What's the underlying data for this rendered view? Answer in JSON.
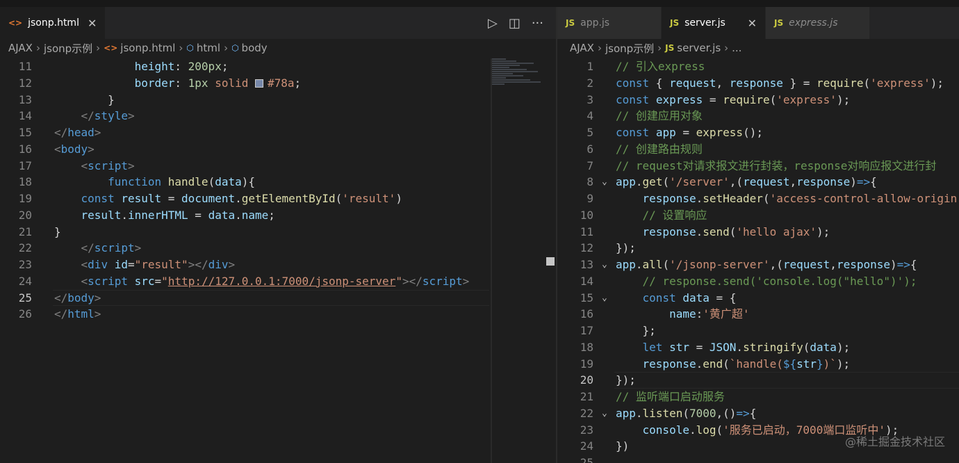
{
  "left": {
    "tab": {
      "name": "jsonp.html",
      "icon": "html-file-icon"
    },
    "actions": {
      "run": "▷",
      "split": "◫",
      "more": "···"
    },
    "breadcrumb": [
      "AJAX",
      "jsonp示例",
      "jsonp.html",
      "html",
      "body"
    ],
    "lines": [
      {
        "n": "11",
        "t": [
          [
            "i",
            "            "
          ],
          [
            "attr",
            "height"
          ],
          [
            "plain",
            ": "
          ],
          [
            "num",
            "200px"
          ],
          [
            "plain",
            ";"
          ]
        ]
      },
      {
        "n": "12",
        "t": [
          [
            "i",
            "            "
          ],
          [
            "attr",
            "border"
          ],
          [
            "plain",
            ": "
          ],
          [
            "num",
            "1px"
          ],
          [
            "plain",
            " "
          ],
          [
            "str",
            "solid"
          ],
          [
            "plain",
            " "
          ],
          [
            "swatch",
            ""
          ],
          [
            "str",
            "#78a"
          ],
          [
            "plain",
            ";"
          ]
        ]
      },
      {
        "n": "13",
        "t": [
          [
            "i",
            "        "
          ],
          [
            "plain",
            "}"
          ]
        ]
      },
      {
        "n": "14",
        "t": [
          [
            "i",
            "    "
          ],
          [
            "punc",
            "</"
          ],
          [
            "tag",
            "style"
          ],
          [
            "punc",
            ">"
          ]
        ]
      },
      {
        "n": "15",
        "t": [
          [
            "punc",
            "</"
          ],
          [
            "tag",
            "head"
          ],
          [
            "punc",
            ">"
          ]
        ]
      },
      {
        "n": "16",
        "t": [
          [
            "punc",
            "<"
          ],
          [
            "tag",
            "body"
          ],
          [
            "punc",
            ">"
          ]
        ]
      },
      {
        "n": "17",
        "t": [
          [
            "i",
            "    "
          ],
          [
            "punc",
            "<"
          ],
          [
            "tag",
            "script"
          ],
          [
            "punc",
            ">"
          ]
        ]
      },
      {
        "n": "18",
        "t": [
          [
            "i",
            "        "
          ],
          [
            "kw",
            "function"
          ],
          [
            "plain",
            " "
          ],
          [
            "fn",
            "handle"
          ],
          [
            "plain",
            "("
          ],
          [
            "var",
            "data"
          ],
          [
            "plain",
            "){"
          ]
        ]
      },
      {
        "n": "19",
        "t": [
          [
            "i",
            "    "
          ],
          [
            "kw",
            "const"
          ],
          [
            "plain",
            " "
          ],
          [
            "var",
            "result"
          ],
          [
            "plain",
            " = "
          ],
          [
            "var",
            "document"
          ],
          [
            "plain",
            "."
          ],
          [
            "fn",
            "getElementById"
          ],
          [
            "plain",
            "("
          ],
          [
            "str",
            "'result'"
          ],
          [
            "plain",
            ")"
          ]
        ]
      },
      {
        "n": "20",
        "t": [
          [
            "i",
            "    "
          ],
          [
            "var",
            "result"
          ],
          [
            "plain",
            "."
          ],
          [
            "var",
            "innerHTML"
          ],
          [
            "plain",
            " = "
          ],
          [
            "var",
            "data"
          ],
          [
            "plain",
            "."
          ],
          [
            "var",
            "name"
          ],
          [
            "plain",
            ";"
          ]
        ]
      },
      {
        "n": "21",
        "t": [
          [
            "plain",
            "}"
          ]
        ]
      },
      {
        "n": "22",
        "t": [
          [
            "i",
            "    "
          ],
          [
            "punc",
            "</"
          ],
          [
            "tag",
            "script"
          ],
          [
            "punc",
            ">"
          ]
        ]
      },
      {
        "n": "23",
        "t": [
          [
            "i",
            "    "
          ],
          [
            "punc",
            "<"
          ],
          [
            "tag",
            "div"
          ],
          [
            "plain",
            " "
          ],
          [
            "attr",
            "id"
          ],
          [
            "plain",
            "="
          ],
          [
            "str",
            "\"result\""
          ],
          [
            "punc",
            "></"
          ],
          [
            "tag",
            "div"
          ],
          [
            "punc",
            ">"
          ]
        ]
      },
      {
        "n": "24",
        "t": [
          [
            "i",
            "    "
          ],
          [
            "punc",
            "<"
          ],
          [
            "tag",
            "script"
          ],
          [
            "plain",
            " "
          ],
          [
            "attr",
            "src"
          ],
          [
            "plain",
            "="
          ],
          [
            "str",
            "\""
          ],
          [
            "stru",
            "http://127.0.0.1:7000/jsonp-server"
          ],
          [
            "str",
            "\""
          ],
          [
            "punc",
            "></"
          ],
          [
            "tag",
            "script"
          ],
          [
            "punc",
            ">"
          ]
        ]
      },
      {
        "n": "25",
        "t": [
          [
            "punc",
            "</"
          ],
          [
            "tag",
            "body"
          ],
          [
            "punc",
            ">"
          ]
        ],
        "current": true
      },
      {
        "n": "26",
        "t": [
          [
            "punc",
            "</"
          ],
          [
            "tag",
            "html"
          ],
          [
            "punc",
            ">"
          ]
        ]
      }
    ]
  },
  "right": {
    "tabs": [
      {
        "name": "app.js",
        "active": false,
        "italic": false,
        "close": ""
      },
      {
        "name": "server.js",
        "active": true,
        "italic": false,
        "close": "✕"
      },
      {
        "name": "express.js",
        "active": false,
        "italic": true,
        "close": ""
      }
    ],
    "js_icon_label": "JS",
    "breadcrumb": [
      "AJAX",
      "jsonp示例",
      "server.js",
      "..."
    ],
    "lines": [
      {
        "n": "1",
        "t": [
          [
            "cmt",
            "// 引入express"
          ]
        ]
      },
      {
        "n": "2",
        "t": [
          [
            "kw",
            "const"
          ],
          [
            "plain",
            " { "
          ],
          [
            "var",
            "request"
          ],
          [
            "plain",
            ", "
          ],
          [
            "var",
            "response"
          ],
          [
            "plain",
            " } = "
          ],
          [
            "fn",
            "require"
          ],
          [
            "plain",
            "("
          ],
          [
            "str",
            "'express'"
          ],
          [
            "plain",
            ");"
          ]
        ]
      },
      {
        "n": "3",
        "t": [
          [
            "kw",
            "const"
          ],
          [
            "plain",
            " "
          ],
          [
            "var",
            "express"
          ],
          [
            "plain",
            " = "
          ],
          [
            "fn",
            "require"
          ],
          [
            "plain",
            "("
          ],
          [
            "str",
            "'express'"
          ],
          [
            "plain",
            ");"
          ]
        ]
      },
      {
        "n": "4",
        "t": [
          [
            "cmt",
            "// 创建应用对象"
          ]
        ]
      },
      {
        "n": "5",
        "t": [
          [
            "kw",
            "const"
          ],
          [
            "plain",
            " "
          ],
          [
            "var",
            "app"
          ],
          [
            "plain",
            " = "
          ],
          [
            "fn",
            "express"
          ],
          [
            "plain",
            "();"
          ]
        ]
      },
      {
        "n": "6",
        "t": [
          [
            "cmt",
            "// 创建路由规则"
          ]
        ]
      },
      {
        "n": "7",
        "t": [
          [
            "cmt",
            "// request对请求报文进行封装，response对响应报文进行封"
          ]
        ]
      },
      {
        "n": "8",
        "fold": true,
        "t": [
          [
            "var",
            "app"
          ],
          [
            "plain",
            "."
          ],
          [
            "fn",
            "get"
          ],
          [
            "plain",
            "("
          ],
          [
            "str",
            "'/server'"
          ],
          [
            "plain",
            ",("
          ],
          [
            "var",
            "request"
          ],
          [
            "plain",
            ","
          ],
          [
            "var",
            "response"
          ],
          [
            "plain",
            ")"
          ],
          [
            "kw",
            "=>"
          ],
          [
            "plain",
            "{"
          ]
        ]
      },
      {
        "n": "9",
        "t": [
          [
            "i",
            "    "
          ],
          [
            "var",
            "response"
          ],
          [
            "plain",
            "."
          ],
          [
            "fn",
            "setHeader"
          ],
          [
            "plain",
            "("
          ],
          [
            "str",
            "'access-control-allow-origin"
          ]
        ]
      },
      {
        "n": "10",
        "t": [
          [
            "i",
            "    "
          ],
          [
            "cmt",
            "// 设置响应"
          ]
        ]
      },
      {
        "n": "11",
        "t": [
          [
            "i",
            "    "
          ],
          [
            "var",
            "response"
          ],
          [
            "plain",
            "."
          ],
          [
            "fn",
            "send"
          ],
          [
            "plain",
            "("
          ],
          [
            "str",
            "'hello ajax'"
          ],
          [
            "plain",
            ");"
          ]
        ]
      },
      {
        "n": "12",
        "t": [
          [
            "plain",
            "});"
          ]
        ]
      },
      {
        "n": "13",
        "fold": true,
        "t": [
          [
            "var",
            "app"
          ],
          [
            "plain",
            "."
          ],
          [
            "fn",
            "all"
          ],
          [
            "plain",
            "("
          ],
          [
            "str",
            "'/jsonp-server'"
          ],
          [
            "plain",
            ",("
          ],
          [
            "var",
            "request"
          ],
          [
            "plain",
            ","
          ],
          [
            "var",
            "response"
          ],
          [
            "plain",
            ")"
          ],
          [
            "kw",
            "=>"
          ],
          [
            "plain",
            "{"
          ]
        ]
      },
      {
        "n": "14",
        "t": [
          [
            "i",
            "    "
          ],
          [
            "cmt",
            "// response.send('console.log(\"hello\")');"
          ]
        ]
      },
      {
        "n": "15",
        "fold": true,
        "t": [
          [
            "i",
            "    "
          ],
          [
            "kw",
            "const"
          ],
          [
            "plain",
            " "
          ],
          [
            "var",
            "data"
          ],
          [
            "plain",
            " = {"
          ]
        ]
      },
      {
        "n": "16",
        "t": [
          [
            "i",
            "        "
          ],
          [
            "var",
            "name"
          ],
          [
            "plain",
            ":"
          ],
          [
            "str",
            "'黄广超'"
          ]
        ]
      },
      {
        "n": "17",
        "t": [
          [
            "i",
            "    "
          ],
          [
            "plain",
            "};"
          ]
        ]
      },
      {
        "n": "18",
        "t": [
          [
            "i",
            "    "
          ],
          [
            "kw",
            "let"
          ],
          [
            "plain",
            " "
          ],
          [
            "var",
            "str"
          ],
          [
            "plain",
            " = "
          ],
          [
            "var",
            "JSON"
          ],
          [
            "plain",
            "."
          ],
          [
            "fn",
            "stringify"
          ],
          [
            "plain",
            "("
          ],
          [
            "var",
            "data"
          ],
          [
            "plain",
            ");"
          ]
        ]
      },
      {
        "n": "19",
        "t": [
          [
            "i",
            "    "
          ],
          [
            "var",
            "response"
          ],
          [
            "plain",
            "."
          ],
          [
            "fn",
            "end"
          ],
          [
            "plain",
            "("
          ],
          [
            "str",
            "`handle("
          ],
          [
            "kw",
            "${"
          ],
          [
            "var",
            "str"
          ],
          [
            "kw",
            "}"
          ],
          [
            "str",
            ")`"
          ],
          [
            "plain",
            ");"
          ]
        ]
      },
      {
        "n": "20",
        "t": [
          [
            "plain",
            "});"
          ]
        ],
        "current": true
      },
      {
        "n": "21",
        "t": [
          [
            "cmt",
            "// 监听端口启动服务"
          ]
        ]
      },
      {
        "n": "22",
        "fold": true,
        "t": [
          [
            "var",
            "app"
          ],
          [
            "plain",
            "."
          ],
          [
            "fn",
            "listen"
          ],
          [
            "plain",
            "("
          ],
          [
            "num",
            "7000"
          ],
          [
            "plain",
            ",()"
          ],
          [
            "kw",
            "=>"
          ],
          [
            "plain",
            "{"
          ]
        ]
      },
      {
        "n": "23",
        "t": [
          [
            "i",
            "    "
          ],
          [
            "var",
            "console"
          ],
          [
            "plain",
            "."
          ],
          [
            "fn",
            "log"
          ],
          [
            "plain",
            "("
          ],
          [
            "str",
            "'服务已启动，7000端口监听中'"
          ],
          [
            "plain",
            ");"
          ]
        ]
      },
      {
        "n": "24",
        "t": [
          [
            "plain",
            "})"
          ]
        ]
      },
      {
        "n": "25",
        "t": []
      }
    ]
  },
  "watermark": "@稀土掘金技术社区",
  "colors": {
    "editor_bg": "#1e1e1e",
    "keyword": "#569cd6",
    "string": "#ce9178",
    "comment": "#6a9955",
    "function": "#dcdcaa",
    "variable": "#9cdcfe",
    "swatch": "#7788aa"
  }
}
